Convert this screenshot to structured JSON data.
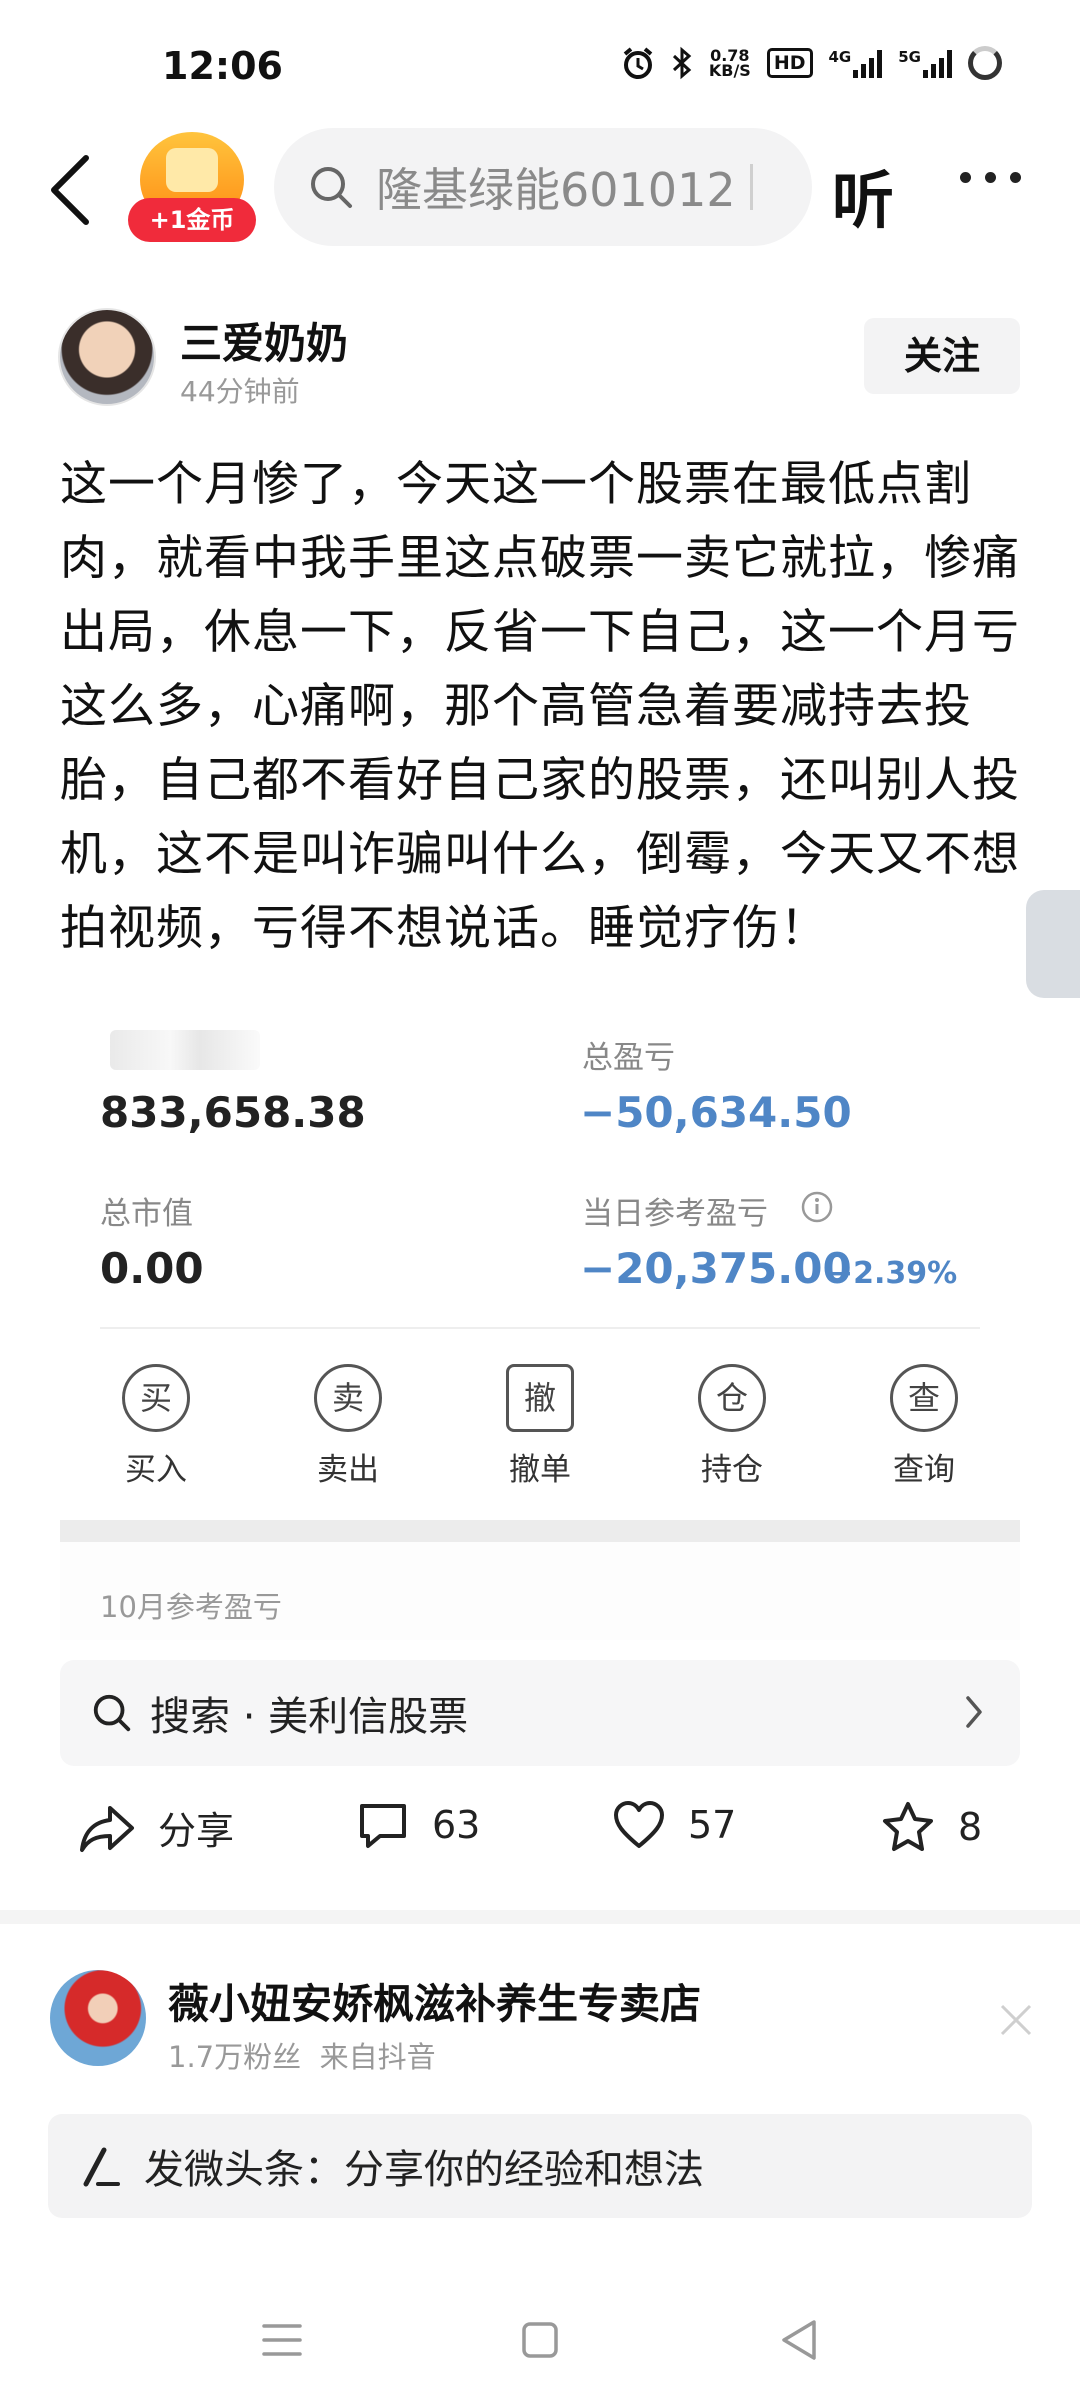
{
  "status_bar": {
    "time": "12:06",
    "net_speed_value": "0.78",
    "net_speed_unit": "KB/S",
    "hd_label": "HD",
    "sim1_label": "4G",
    "sim2_label": "5G"
  },
  "header": {
    "coin_badge": "+1金币",
    "search_placeholder": "隆基绿能601012",
    "listen_label": "听"
  },
  "author": {
    "name": "三爱奶奶",
    "time": "44分钟前",
    "follow_label": "关注"
  },
  "post": {
    "text": "这一个月惨了，今天这一个股票在最低点割肉，就看中我手里这点破票一卖它就拉，惨痛出局，休息一下，反省一下自己，这一个月亏这么多，心痛啊，那个高管急着要减持去投胎，自己都不看好自己家的股票，还叫别人投机，这不是叫诈骗叫什么，倒霉，今天又不想拍视频，亏得不想说话。睡觉疗伤！"
  },
  "account_card": {
    "asset_value": "833,658.38",
    "total_pnl_label": "总盈亏",
    "total_pnl_value": "−50,634.50",
    "market_value_label": "总市值",
    "market_value": "0.00",
    "daily_pnl_label": "当日参考盈亏",
    "daily_pnl_value": "−20,375.00",
    "daily_pnl_pct": "−2.39%",
    "actions": [
      {
        "icon_char": "买",
        "label": "买入"
      },
      {
        "icon_char": "卖",
        "label": "卖出"
      },
      {
        "icon_char": "撤",
        "label": "撤单"
      },
      {
        "icon_char": "仓",
        "label": "持仓"
      },
      {
        "icon_char": "查",
        "label": "查询"
      }
    ],
    "month_label": "10月参考盈亏"
  },
  "related_search": {
    "text": "搜索 · 美利信股票"
  },
  "engagement": {
    "share_label": "分享",
    "comments": "63",
    "likes": "57",
    "favorites": "8"
  },
  "recommendation": {
    "name": "薇小妞安娇枫滋补养生专卖店",
    "followers": "1.7万粉丝",
    "source": "来自抖音"
  },
  "composer": {
    "placeholder": "发微头条：分享你的经验和想法"
  },
  "colors": {
    "negative": "#4f86c6",
    "coin_red": "#f02b3b",
    "coin_orange": "#ff8a12"
  }
}
